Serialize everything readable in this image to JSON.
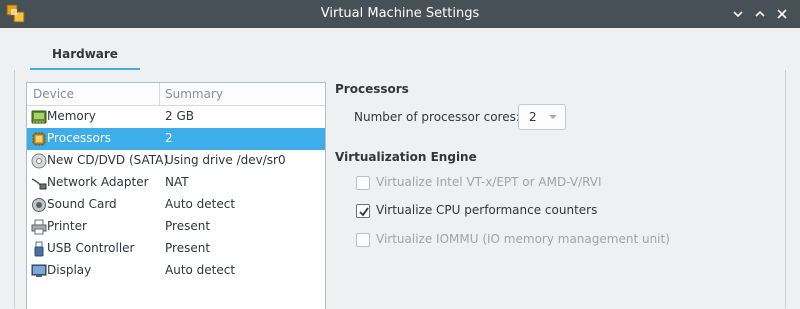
{
  "window": {
    "title": "Virtual Machine Settings"
  },
  "tabs": [
    {
      "label": "Hardware"
    }
  ],
  "devices": {
    "columns": {
      "device": "Device",
      "summary": "Summary"
    },
    "rows": [
      {
        "name": "Memory",
        "summary": "2 GB",
        "icon": "memory-icon"
      },
      {
        "name": "Processors",
        "summary": "2",
        "icon": "processor-icon",
        "selected": true
      },
      {
        "name": "New CD/DVD (SATA)",
        "summary": "Using drive /dev/sr0",
        "icon": "cd-dvd-icon"
      },
      {
        "name": "Network Adapter",
        "summary": "NAT",
        "icon": "network-adapter-icon"
      },
      {
        "name": "Sound Card",
        "summary": "Auto detect",
        "icon": "sound-card-icon"
      },
      {
        "name": "Printer",
        "summary": "Present",
        "icon": "printer-icon"
      },
      {
        "name": "USB Controller",
        "summary": "Present",
        "icon": "usb-icon"
      },
      {
        "name": "Display",
        "summary": "Auto detect",
        "icon": "display-icon"
      }
    ]
  },
  "processors": {
    "title": "Processors",
    "cores_label": "Number of processor cores:",
    "cores_value": "2"
  },
  "virtualization": {
    "title": "Virtualization Engine",
    "options": [
      {
        "label": "Virtualize Intel VT-x/EPT or AMD-V/RVI",
        "checked": false,
        "enabled": false
      },
      {
        "label": "Virtualize CPU performance counters",
        "checked": true,
        "enabled": true
      },
      {
        "label": "Virtualize IOMMU (IO memory management unit)",
        "checked": false,
        "enabled": false
      }
    ]
  },
  "colors": {
    "accent": "#3daee9",
    "titlebar": "#475057"
  }
}
